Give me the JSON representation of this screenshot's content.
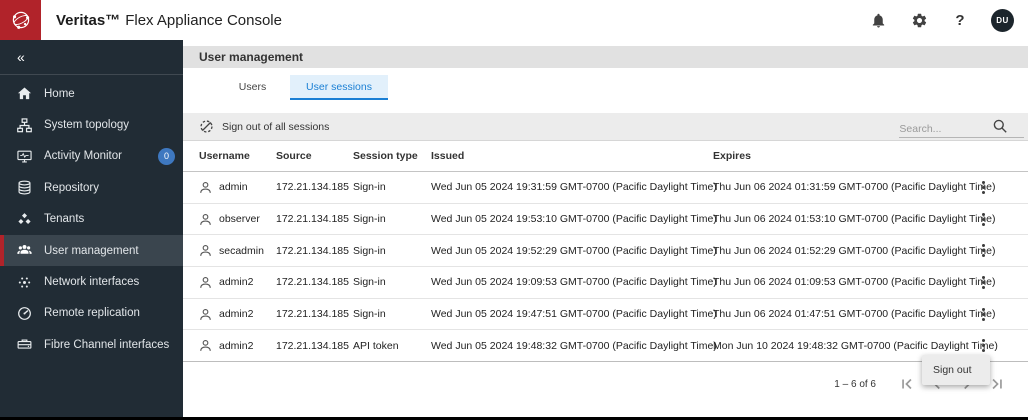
{
  "header": {
    "brand_bold": "Veritas™",
    "brand_rest": "Flex Appliance Console",
    "help_label": "?",
    "avatar_initials": "DU"
  },
  "sidebar": {
    "collapse_glyph": "«",
    "items": [
      {
        "label": "Home"
      },
      {
        "label": "System topology"
      },
      {
        "label": "Activity Monitor",
        "badge": "0"
      },
      {
        "label": "Repository"
      },
      {
        "label": "Tenants"
      },
      {
        "label": "User management"
      },
      {
        "label": "Network interfaces"
      },
      {
        "label": "Remote replication"
      },
      {
        "label": "Fibre Channel interfaces"
      }
    ]
  },
  "main": {
    "page_title": "User management",
    "tabs": [
      {
        "label": "Users"
      },
      {
        "label": "User sessions"
      }
    ],
    "toolbar": {
      "sign_out_all_label": "Sign out of all sessions",
      "search_placeholder": "Search..."
    },
    "table": {
      "columns": [
        "Username",
        "Source",
        "Session type",
        "Issued",
        "Expires"
      ],
      "rows": [
        {
          "username": "admin",
          "source": "172.21.134.185",
          "session_type": "Sign-in",
          "issued": "Wed Jun 05 2024 19:31:59 GMT-0700 (Pacific Daylight Time)",
          "expires": "Thu Jun 06 2024 01:31:59 GMT-0700 (Pacific Daylight Time)"
        },
        {
          "username": "observer",
          "source": "172.21.134.185",
          "session_type": "Sign-in",
          "issued": "Wed Jun 05 2024 19:53:10 GMT-0700 (Pacific Daylight Time)",
          "expires": "Thu Jun 06 2024 01:53:10 GMT-0700 (Pacific Daylight Time)"
        },
        {
          "username": "secadmin",
          "source": "172.21.134.185",
          "session_type": "Sign-in",
          "issued": "Wed Jun 05 2024 19:52:29 GMT-0700 (Pacific Daylight Time)",
          "expires": "Thu Jun 06 2024 01:52:29 GMT-0700 (Pacific Daylight Time)"
        },
        {
          "username": "admin2",
          "source": "172.21.134.185",
          "session_type": "Sign-in",
          "issued": "Wed Jun 05 2024 19:09:53 GMT-0700 (Pacific Daylight Time)",
          "expires": "Thu Jun 06 2024 01:09:53 GMT-0700 (Pacific Daylight Time)"
        },
        {
          "username": "admin2",
          "source": "172.21.134.185",
          "session_type": "Sign-in",
          "issued": "Wed Jun 05 2024 19:47:51 GMT-0700 (Pacific Daylight Time)",
          "expires": "Thu Jun 06 2024 01:47:51 GMT-0700 (Pacific Daylight Time)"
        },
        {
          "username": "admin2",
          "source": "172.21.134.185",
          "session_type": "API token",
          "issued": "Wed Jun 05 2024 19:48:32 GMT-0700 (Pacific Daylight Time)",
          "expires": "Mon Jun 10 2024 19:48:32 GMT-0700 (Pacific Daylight Time)"
        }
      ]
    },
    "pagination": {
      "range_label": "1 – 6 of 6"
    },
    "context_menu": {
      "sign_out_label": "Sign out"
    }
  },
  "colors": {
    "brand_red": "#b1232a",
    "sidebar_bg": "#212c35",
    "accent_blue": "#1a7fd4",
    "badge_blue": "#3e78c0"
  }
}
